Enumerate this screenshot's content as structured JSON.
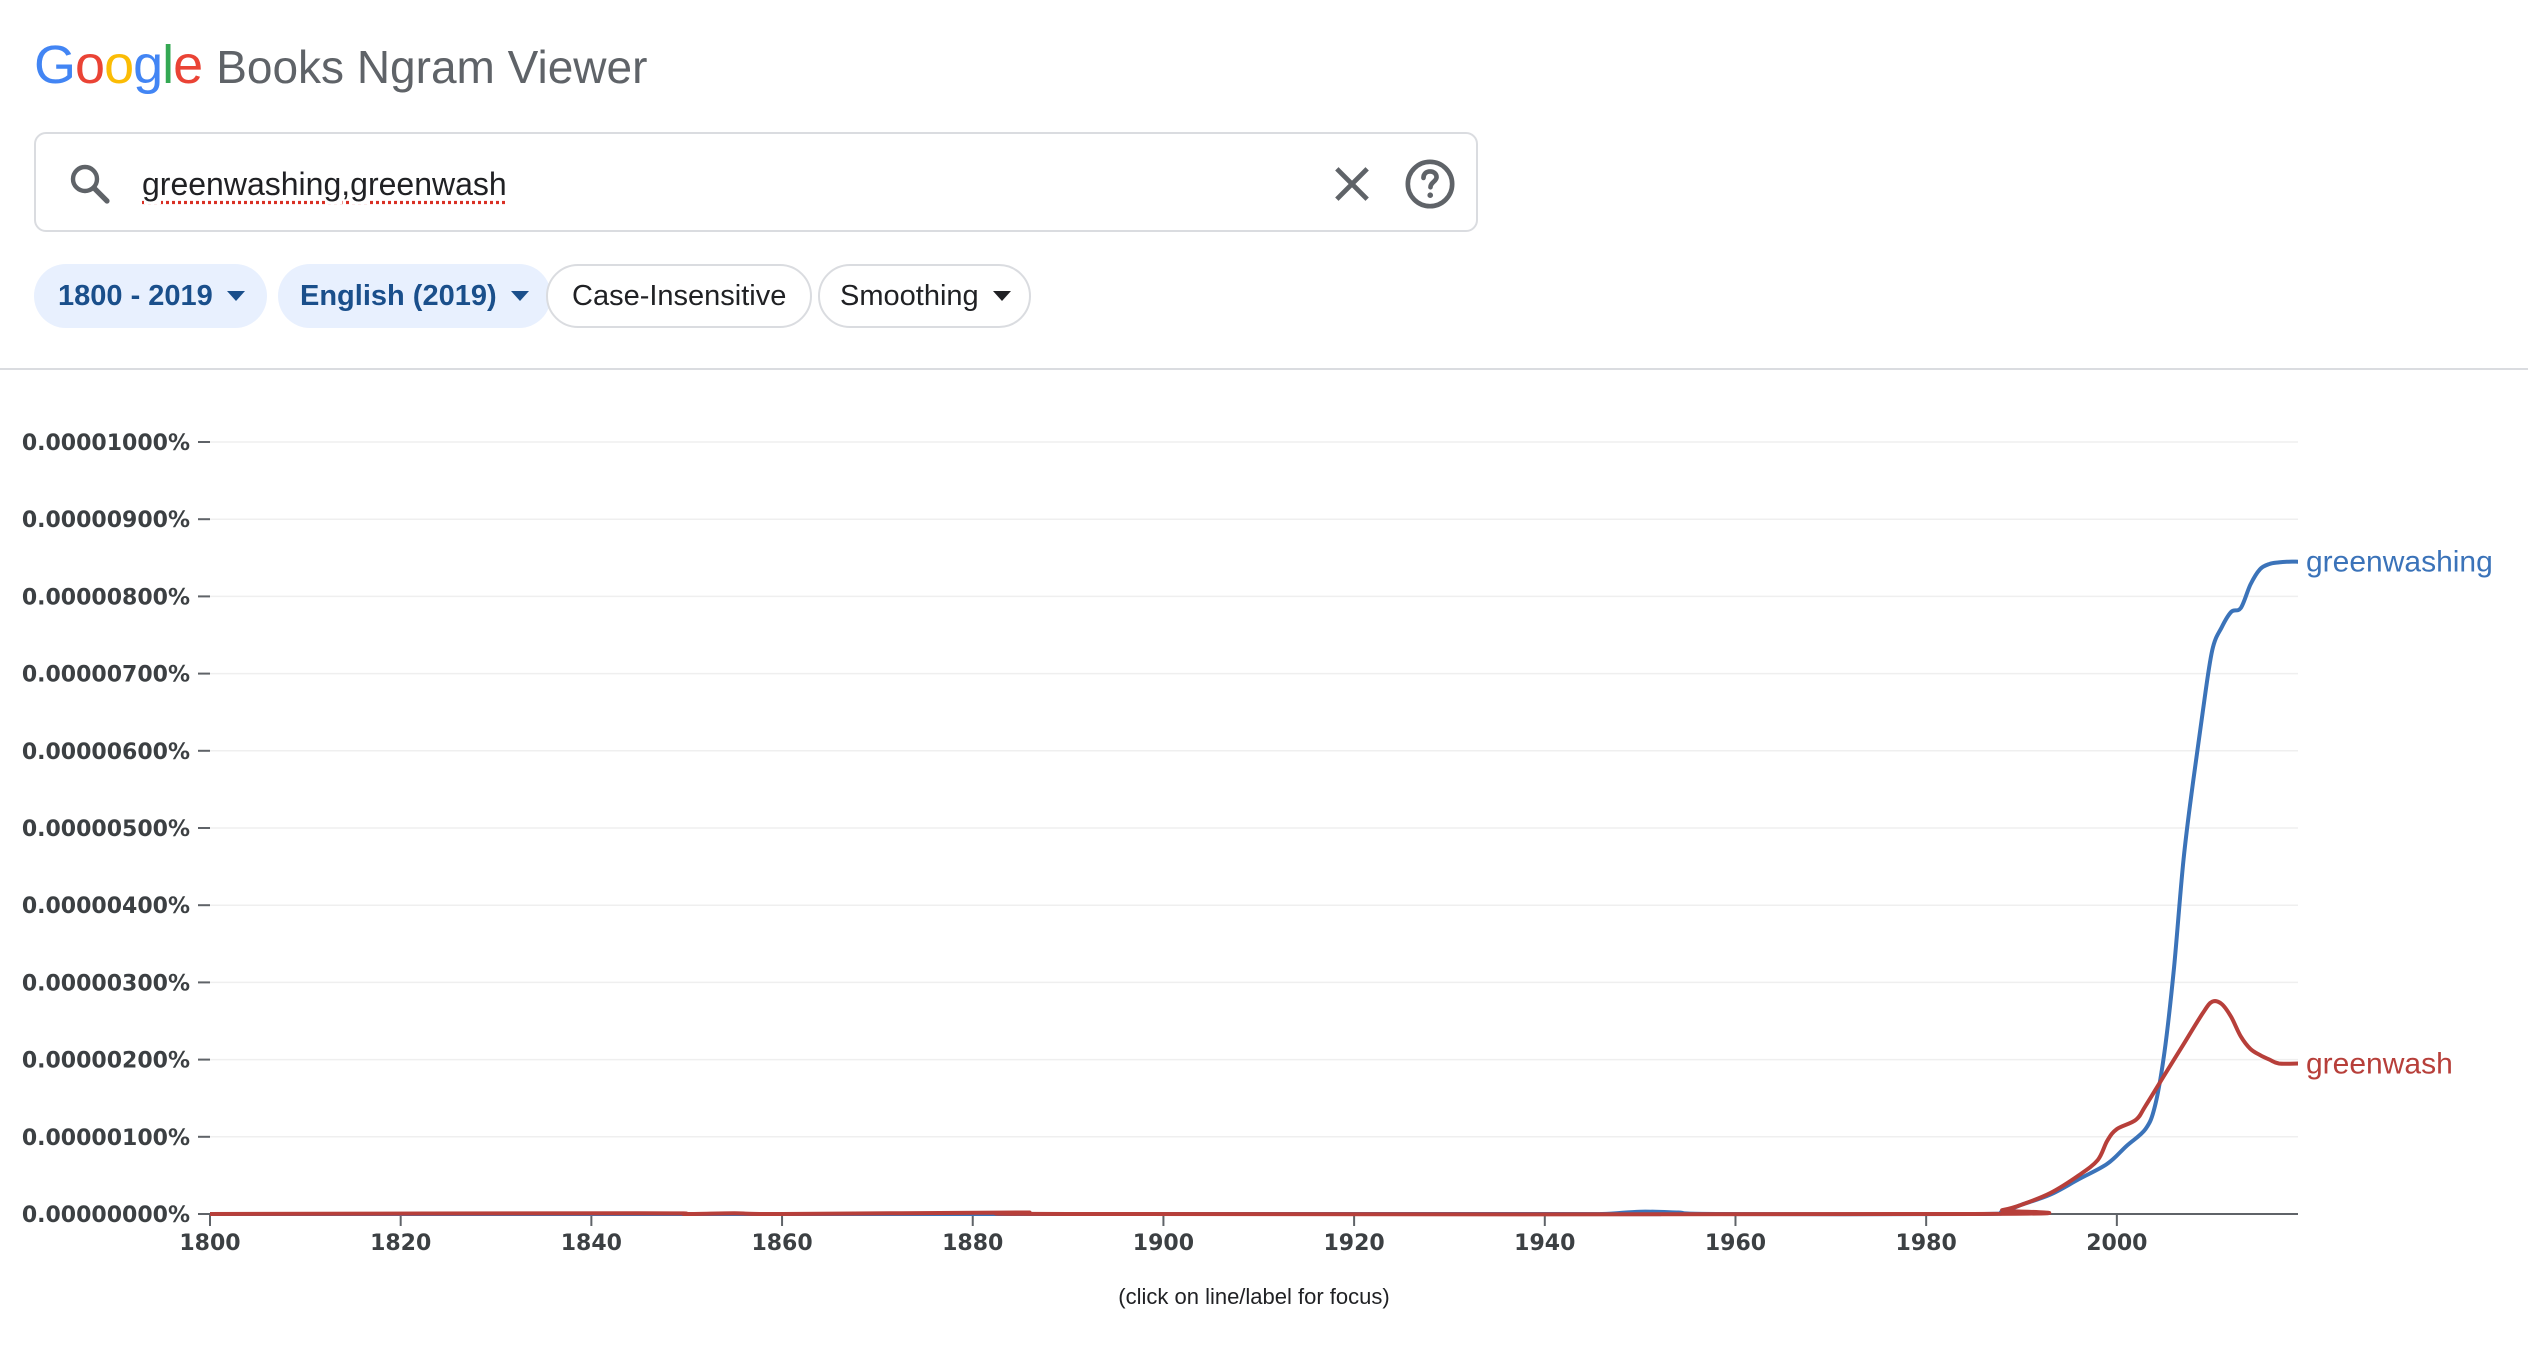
{
  "header": {
    "logo_letters": [
      {
        "char": "G",
        "color": "#4285F4"
      },
      {
        "char": "o",
        "color": "#EA4335"
      },
      {
        "char": "o",
        "color": "#FBBC05"
      },
      {
        "char": "g",
        "color": "#4285F4"
      },
      {
        "char": "l",
        "color": "#34A853"
      },
      {
        "char": "e",
        "color": "#EA4335"
      }
    ],
    "product_name": "Books Ngram Viewer"
  },
  "search": {
    "query": "greenwashing,greenwash",
    "search_icon": "search-icon",
    "clear_icon": "close-icon",
    "help_icon": "help-circle-icon"
  },
  "filters": {
    "year_range": "1800 - 2019",
    "corpus": "English (2019)",
    "case": "Case-Insensitive",
    "smoothing": "Smoothing"
  },
  "colors": {
    "greenwashing": "#3b73b9",
    "greenwash": "#b73f3a",
    "chip_active_bg": "#e8f0fe",
    "chip_active_text": "#1a4f8b"
  },
  "chart_data": {
    "type": "line",
    "y_tick_labels": [
      "0.00000000%",
      "0.00000100%",
      "0.00000200%",
      "0.00000300%",
      "0.00000400%",
      "0.00000500%",
      "0.00000600%",
      "0.00000700%",
      "0.00000800%",
      "0.00000900%",
      "0.00001000%"
    ],
    "y_ticks": [
      0,
      1e-06,
      2e-06,
      3e-06,
      4e-06,
      5e-06,
      6e-06,
      7e-06,
      8e-06,
      9e-06,
      1e-05
    ],
    "x_ticks": [
      1800,
      1820,
      1840,
      1860,
      1880,
      1900,
      1920,
      1940,
      1960,
      1980,
      2000
    ],
    "xlim": [
      1800,
      2019
    ],
    "ylim": [
      0,
      1e-05
    ],
    "grid": true,
    "series": [
      {
        "name": "greenwashing",
        "points": [
          [
            1800,
            0
          ],
          [
            1940,
            0
          ],
          [
            1946,
            0
          ],
          [
            1950,
            3e-08
          ],
          [
            1954,
            2e-08
          ],
          [
            1958,
            0
          ],
          [
            1985,
            0
          ],
          [
            1988,
            3e-08
          ],
          [
            1990,
            1.2e-07
          ],
          [
            1993,
            2.5e-07
          ],
          [
            1996,
            4.5e-07
          ],
          [
            1999,
            6.5e-07
          ],
          [
            2001,
            8.8e-07
          ],
          [
            2003,
            1.1e-06
          ],
          [
            2004,
            1.4e-06
          ],
          [
            2005,
            2.1e-06
          ],
          [
            2006,
            3.2e-06
          ],
          [
            2007,
            4.6e-06
          ],
          [
            2008,
            5.6e-06
          ],
          [
            2009,
            6.5e-06
          ],
          [
            2010,
            7.3e-06
          ],
          [
            2011,
            7.6e-06
          ],
          [
            2012,
            7.8e-06
          ],
          [
            2013,
            7.85e-06
          ],
          [
            2014,
            8.15e-06
          ],
          [
            2015,
            8.35e-06
          ],
          [
            2016,
            8.42e-06
          ],
          [
            2017,
            8.44e-06
          ],
          [
            2018,
            8.45e-06
          ],
          [
            2019,
            8.45e-06
          ]
        ]
      },
      {
        "name": "greenwash",
        "points": [
          [
            1800,
            0
          ],
          [
            1845,
            1e-08
          ],
          [
            1850,
            0
          ],
          [
            1855,
            1e-08
          ],
          [
            1860,
            0
          ],
          [
            1885,
            2e-08
          ],
          [
            1890,
            0
          ],
          [
            1985,
            0
          ],
          [
            1988,
            5e-08
          ],
          [
            1990,
            1.2e-07
          ],
          [
            1993,
            2.7e-07
          ],
          [
            1996,
            5e-07
          ],
          [
            1998,
            7e-07
          ],
          [
            1999,
            9.5e-07
          ],
          [
            2000,
            1.1e-06
          ],
          [
            2002,
            1.22e-06
          ],
          [
            2003,
            1.4e-06
          ],
          [
            2005,
            1.8e-06
          ],
          [
            2007,
            2.2e-06
          ],
          [
            2009,
            2.6e-06
          ],
          [
            2010,
            2.75e-06
          ],
          [
            2011,
            2.72e-06
          ],
          [
            2012,
            2.55e-06
          ],
          [
            2013,
            2.3e-06
          ],
          [
            2014,
            2.14e-06
          ],
          [
            2015,
            2.06e-06
          ],
          [
            2016,
            2e-06
          ],
          [
            2017,
            1.95e-06
          ],
          [
            2019,
            1.95e-06
          ]
        ]
      }
    ],
    "note": "(click on line/label for focus)"
  }
}
